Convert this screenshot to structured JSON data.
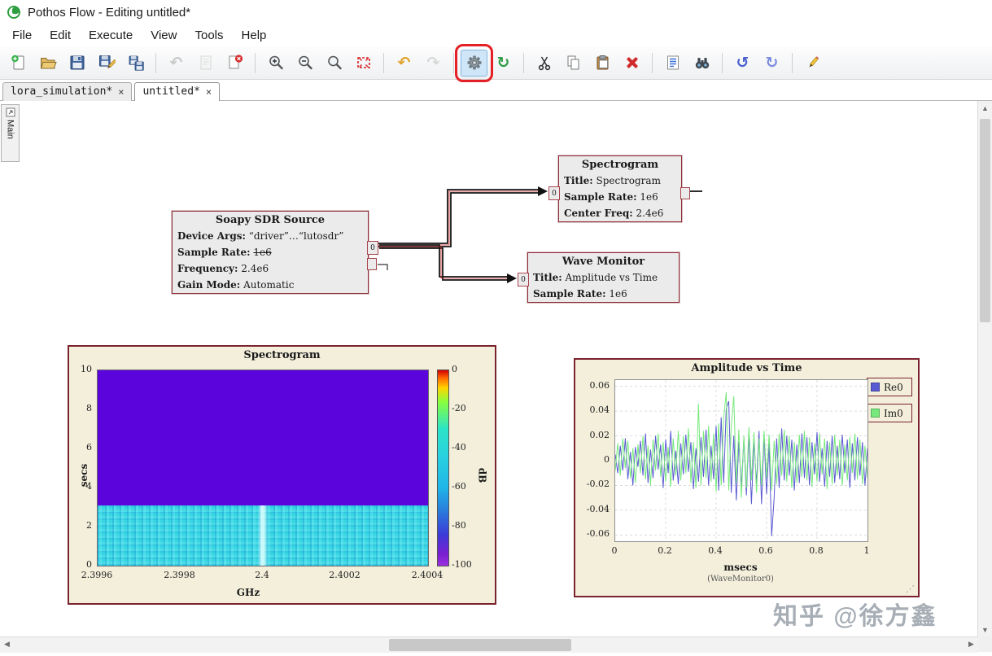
{
  "window": {
    "title": "Pothos Flow - Editing untitled*",
    "app_icon": "pothos-leaf-logo"
  },
  "menu": {
    "items": [
      "File",
      "Edit",
      "Execute",
      "View",
      "Tools",
      "Help"
    ]
  },
  "toolbar": {
    "buttons": [
      "new",
      "open",
      "save",
      "save-as",
      "save-all",
      "reload-page",
      "export",
      "close-page",
      "zoom-in",
      "zoom-out",
      "zoom-original",
      "zoom-fit",
      "undo",
      "redo",
      "activate-topology",
      "reload-topology",
      "cut",
      "copy",
      "paste",
      "delete",
      "log",
      "find",
      "rotate-left",
      "rotate-right",
      "edit-properties"
    ],
    "highlighted_button": "activate-topology",
    "highlight_color": "#e41f25"
  },
  "tabs": [
    {
      "label": "lora_simulation*",
      "close": "×",
      "active": false
    },
    {
      "label": "untitled*",
      "close": "×",
      "active": true
    }
  ],
  "side_tab": {
    "label": "Main"
  },
  "flow_graph": {
    "blocks": [
      {
        "title": "Soapy SDR Source",
        "props": [
          {
            "key": "Device Args:",
            "value": "“driver”…“lutosdr”"
          },
          {
            "key": "Sample Rate:",
            "value": "1e6",
            "struck": true
          },
          {
            "key": "Frequency:",
            "value": "2.4e6"
          },
          {
            "key": "Gain Mode:",
            "value": "Automatic"
          }
        ],
        "out_port": "0"
      },
      {
        "title": "Spectrogram",
        "props": [
          {
            "key": "Title:",
            "value": "Spectrogram"
          },
          {
            "key": "Sample Rate:",
            "value": "1e6"
          },
          {
            "key": "Center Freq:",
            "value": "2.4e6"
          }
        ],
        "in_port": "0"
      },
      {
        "title": "Wave Monitor",
        "props": [
          {
            "key": "Title:",
            "value": "Amplitude vs Time"
          },
          {
            "key": "Sample Rate:",
            "value": "1e6"
          }
        ],
        "in_port": "0"
      }
    ],
    "connections": [
      {
        "from": "Soapy SDR Source[0]",
        "to": "Spectrogram[0]"
      },
      {
        "from": "Soapy SDR Source[0]",
        "to": "Wave Monitor[0]"
      }
    ]
  },
  "chart_data": [
    {
      "type": "heatmap",
      "title": "Spectrogram",
      "xlabel": "GHz",
      "ylabel": "secs",
      "xlim": [
        2.3995,
        2.4005
      ],
      "x_ticks": [
        "2.3996",
        "2.3998",
        "2.4",
        "2.4002",
        "2.4004"
      ],
      "ylim": [
        0,
        10
      ],
      "y_ticks": [
        10,
        8,
        6,
        4,
        2,
        0
      ],
      "colorbar": {
        "label": "dB",
        "ticks": [
          0,
          -20,
          -40,
          -60,
          -80,
          -100
        ],
        "range": [
          -100,
          0
        ]
      },
      "regions": [
        {
          "secs_from": 3.1,
          "secs_to": 10,
          "approx_db": -100,
          "color": "#5c04dc",
          "desc": "uniform purple region (no signal history)"
        },
        {
          "secs_from": 0,
          "secs_to": 3.1,
          "approx_db": -65,
          "color": "#38d6e2",
          "desc": "cyan noise floor with faint bright carrier line at 2.4 GHz"
        }
      ]
    },
    {
      "type": "line",
      "title": "Amplitude vs Time",
      "xlabel": "msecs",
      "sublabel": "(WaveMonitor0)",
      "xlim": [
        0,
        1
      ],
      "x_ticks": [
        0,
        0.2,
        0.4,
        0.6,
        0.8,
        1
      ],
      "ylim": [
        -0.065,
        0.065
      ],
      "y_ticks": [
        0.06,
        0.04,
        0.02,
        0,
        -0.02,
        -0.04,
        -0.06
      ],
      "legend": [
        {
          "name": "Re0",
          "color": "#5a5ad2"
        },
        {
          "name": "Im0",
          "color": "#77e97c"
        }
      ],
      "series": [
        {
          "name": "Re0",
          "color": "#5a5ad2",
          "values": [
            0.005,
            -0.01,
            0.012,
            -0.008,
            0.018,
            -0.015,
            0.007,
            -0.02,
            0.011,
            -0.005,
            0.016,
            -0.012,
            0.022,
            -0.018,
            0.009,
            -0.014,
            0.02,
            -0.007,
            0.013,
            -0.022,
            0.017,
            -0.01,
            0.024,
            -0.016,
            0.008,
            -0.019,
            0.014,
            -0.011,
            0.021,
            -0.009,
            0.015,
            -0.023,
            0.01,
            -0.017,
            0.019,
            -0.013,
            0.025,
            -0.02,
            0.012,
            -0.015,
            0.028,
            -0.024,
            0.035,
            -0.018,
            0.042,
            0.048,
            -0.026,
            0.02,
            -0.032,
            0.015,
            -0.021,
            0.018,
            -0.028,
            0.022,
            -0.035,
            0.016,
            -0.019,
            0.024,
            -0.035,
            0.02,
            -0.027,
            0.014,
            -0.061,
            -0.03,
            0.018,
            -0.022,
            0.026,
            -0.016,
            0.02,
            -0.012,
            0.017,
            -0.024,
            0.013,
            -0.018,
            0.022,
            -0.014,
            0.019,
            -0.02,
            0.015,
            -0.011,
            0.023,
            -0.017,
            0.01,
            -0.021,
            0.016,
            -0.013,
            0.02,
            -0.018,
            0.012,
            -0.015,
            0.021,
            -0.01,
            0.017,
            -0.022,
            0.014,
            -0.016,
            0.019,
            -0.012,
            0.015,
            -0.02,
            0.01
          ]
        },
        {
          "name": "Im0",
          "color": "#77e97c",
          "values": [
            -0.008,
            0.014,
            -0.012,
            0.018,
            -0.006,
            0.016,
            -0.014,
            0.01,
            -0.018,
            0.013,
            -0.01,
            0.02,
            -0.015,
            0.012,
            -0.02,
            0.017,
            -0.008,
            0.022,
            -0.013,
            0.015,
            -0.017,
            0.011,
            -0.021,
            0.018,
            -0.012,
            0.024,
            -0.016,
            0.02,
            -0.01,
            0.026,
            -0.018,
            0.015,
            -0.022,
            0.046,
            -0.02,
            0.024,
            -0.014,
            0.028,
            -0.017,
            0.022,
            -0.025,
            0.03,
            -0.02,
            0.035,
            0.055,
            -0.024,
            0.028,
            0.052,
            -0.018,
            0.025,
            -0.03,
            0.02,
            -0.022,
            0.027,
            -0.016,
            0.023,
            -0.026,
            0.018,
            -0.02,
            0.024,
            -0.014,
            0.021,
            -0.024,
            0.016,
            -0.019,
            0.022,
            -0.012,
            0.025,
            -0.017,
            0.02,
            -0.022,
            0.015,
            -0.018,
            0.021,
            -0.013,
            0.024,
            -0.016,
            0.019,
            -0.021,
            0.014,
            -0.017,
            0.022,
            -0.011,
            0.018,
            -0.023,
            0.015,
            -0.019,
            0.021,
            -0.012,
            0.017,
            -0.02,
            0.013,
            -0.016,
            0.019,
            -0.01,
            0.022,
            -0.015,
            0.017,
            -0.019,
            0.012,
            -0.014
          ]
        }
      ]
    }
  ],
  "watermark": {
    "text": "知乎 @徐方鑫"
  }
}
